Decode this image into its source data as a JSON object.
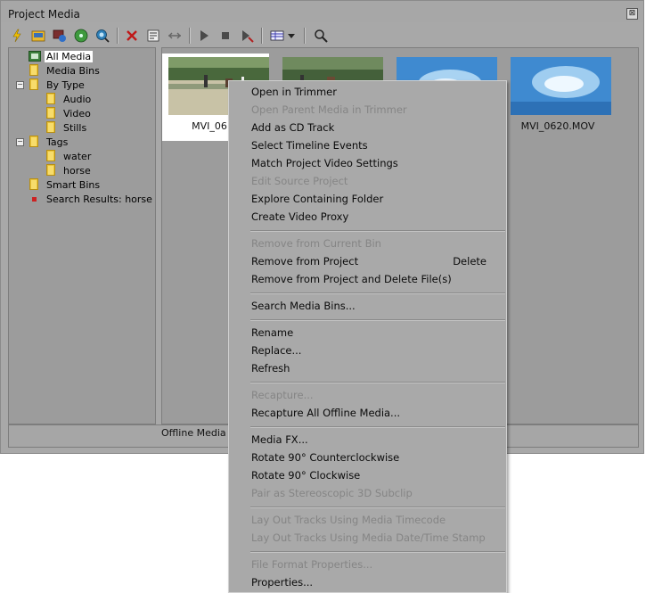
{
  "window": {
    "title": "Project Media",
    "close_glyph": "⊠"
  },
  "toolbar": {
    "icons": [
      "import-media-icon",
      "capture-video-icon",
      "get-media-from-web-icon",
      "rip-cd-icon",
      "search-media-icon",
      "remove-media-icon",
      "properties-icon",
      "replace-media-icon",
      "play-icon",
      "stop-icon",
      "auto-preview-icon",
      "views-icon",
      "views-dropdown-icon",
      "find-icon"
    ]
  },
  "tree": {
    "items": [
      {
        "label": "All Media",
        "selected": true
      },
      {
        "label": "Media Bins"
      },
      {
        "label": "By Type",
        "expander": "−"
      },
      {
        "label": "Audio"
      },
      {
        "label": "Video"
      },
      {
        "label": "Stills"
      },
      {
        "label": "Tags",
        "expander": "−"
      },
      {
        "label": "water"
      },
      {
        "label": "horse"
      },
      {
        "label": "Smart Bins"
      },
      {
        "label": "Search Results: horse"
      }
    ]
  },
  "media": {
    "tiles": [
      {
        "label": "MVI_0613",
        "selected": true,
        "kind": "horse"
      },
      {
        "label": "",
        "kind": "horse"
      },
      {
        "label": "",
        "kind": "water"
      },
      {
        "label": "MVI_0620.MOV",
        "kind": "water"
      }
    ]
  },
  "status": {
    "text": "Offline Media Fil"
  },
  "context_menu": {
    "groups": [
      [
        {
          "label": "Open in Trimmer"
        },
        {
          "label": "Open Parent Media in Trimmer",
          "disabled": true
        },
        {
          "label": "Add as CD Track"
        },
        {
          "label": "Select Timeline Events"
        },
        {
          "label": "Match Project Video Settings"
        },
        {
          "label": "Edit Source Project",
          "disabled": true
        },
        {
          "label": "Explore Containing Folder"
        },
        {
          "label": "Create Video Proxy"
        }
      ],
      [
        {
          "label": "Remove from Current Bin",
          "disabled": true
        },
        {
          "label": "Remove from Project",
          "shortcut": "Delete"
        },
        {
          "label": "Remove from Project and Delete File(s)"
        }
      ],
      [
        {
          "label": "Search Media Bins..."
        }
      ],
      [
        {
          "label": "Rename"
        },
        {
          "label": "Replace..."
        },
        {
          "label": "Refresh"
        }
      ],
      [
        {
          "label": "Recapture...",
          "disabled": true
        },
        {
          "label": "Recapture All Offline Media..."
        }
      ],
      [
        {
          "label": "Media FX..."
        },
        {
          "label": "Rotate 90° Counterclockwise"
        },
        {
          "label": "Rotate 90° Clockwise"
        },
        {
          "label": "Pair as Stereoscopic 3D Subclip",
          "disabled": true
        }
      ],
      [
        {
          "label": "Lay Out Tracks Using Media Timecode",
          "disabled": true
        },
        {
          "label": "Lay Out Tracks Using Media Date/Time Stamp",
          "disabled": true
        }
      ],
      [
        {
          "label": "File Format Properties...",
          "disabled": true
        },
        {
          "label": "Properties..."
        }
      ]
    ]
  }
}
